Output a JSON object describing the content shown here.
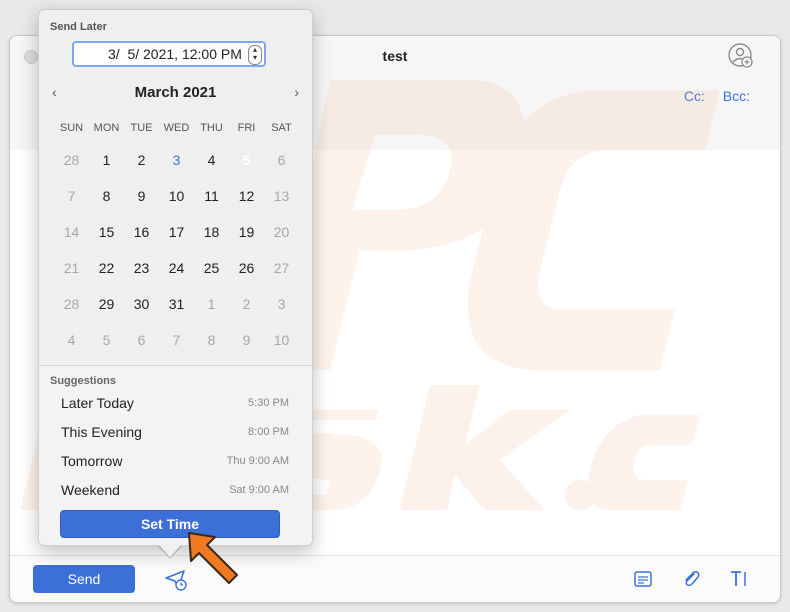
{
  "window": {
    "title": "test",
    "cc_label": "Cc:",
    "bcc_label": "Bcc:",
    "send_label": "Send"
  },
  "popover": {
    "heading": "Send Later",
    "datetime_value": "3/  5/ 2021, 12:00 PM",
    "month_label": "March 2021",
    "nav_prev": "‹",
    "nav_next": "›",
    "weekdays": [
      "SUN",
      "MON",
      "TUE",
      "WED",
      "THU",
      "FRI",
      "SAT"
    ],
    "days": [
      {
        "n": "28",
        "state": "muted"
      },
      {
        "n": "1"
      },
      {
        "n": "2"
      },
      {
        "n": "3",
        "state": "today"
      },
      {
        "n": "4"
      },
      {
        "n": "5",
        "state": "selected"
      },
      {
        "n": "6",
        "state": "muted"
      },
      {
        "n": "7",
        "state": "muted"
      },
      {
        "n": "8"
      },
      {
        "n": "9"
      },
      {
        "n": "10"
      },
      {
        "n": "11"
      },
      {
        "n": "12"
      },
      {
        "n": "13",
        "state": "muted"
      },
      {
        "n": "14",
        "state": "muted"
      },
      {
        "n": "15"
      },
      {
        "n": "16"
      },
      {
        "n": "17"
      },
      {
        "n": "18"
      },
      {
        "n": "19"
      },
      {
        "n": "20",
        "state": "muted"
      },
      {
        "n": "21",
        "state": "muted"
      },
      {
        "n": "22"
      },
      {
        "n": "23"
      },
      {
        "n": "24"
      },
      {
        "n": "25"
      },
      {
        "n": "26"
      },
      {
        "n": "27",
        "state": "muted"
      },
      {
        "n": "28",
        "state": "muted"
      },
      {
        "n": "29"
      },
      {
        "n": "30"
      },
      {
        "n": "31"
      },
      {
        "n": "1",
        "state": "muted"
      },
      {
        "n": "2",
        "state": "muted"
      },
      {
        "n": "3",
        "state": "muted"
      },
      {
        "n": "4",
        "state": "muted"
      },
      {
        "n": "5",
        "state": "muted"
      },
      {
        "n": "6",
        "state": "muted"
      },
      {
        "n": "7",
        "state": "muted"
      },
      {
        "n": "8",
        "state": "muted"
      },
      {
        "n": "9",
        "state": "muted"
      },
      {
        "n": "10",
        "state": "muted"
      }
    ],
    "suggestions_title": "Suggestions",
    "suggestions": [
      {
        "label": "Later Today",
        "time": "5:30 PM"
      },
      {
        "label": "This Evening",
        "time": "8:00 PM"
      },
      {
        "label": "Tomorrow",
        "time": "Thu 9:00 AM"
      },
      {
        "label": "Weekend",
        "time": "Sat 9:00 AM"
      }
    ],
    "set_time_label": "Set Time"
  },
  "colors": {
    "accent": "#3d6fd8",
    "link": "#3b73d9",
    "today_bg": "#d6e2f6",
    "pointer": "#f07a22"
  },
  "icons": [
    "contacts-add-icon",
    "schedule-send-icon",
    "header-fields-icon",
    "attachment-icon",
    "format-text-icon",
    "pointer-arrow-icon"
  ]
}
